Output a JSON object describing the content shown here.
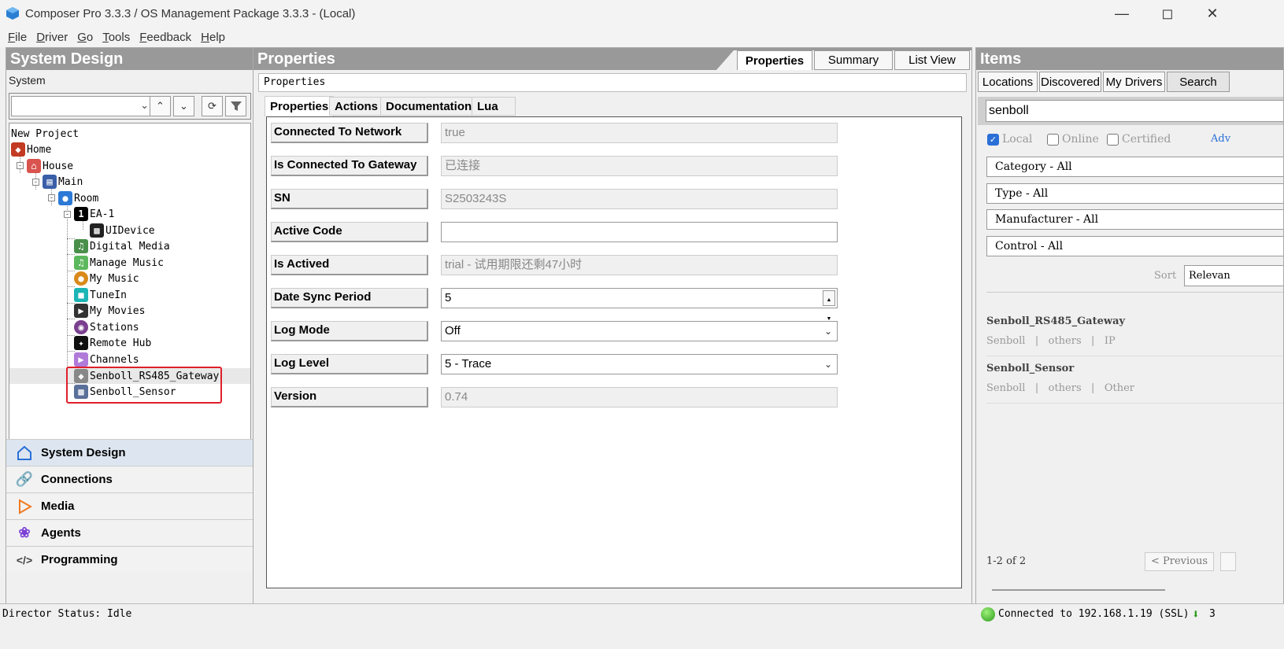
{
  "window": {
    "title": "Composer Pro 3.3.3 / OS Management Package 3.3.3 - (Local)"
  },
  "menu": [
    "File",
    "Driver",
    "Go",
    "Tools",
    "Feedback",
    "Help"
  ],
  "left": {
    "header": "System Design",
    "system_label": "System",
    "combo_value": "",
    "tree": [
      {
        "label": "New Project",
        "icon": "project-icon"
      },
      {
        "label": "Home",
        "icon": "home-icon"
      },
      {
        "label": "House",
        "icon": "house-icon"
      },
      {
        "label": "Main",
        "icon": "floor-icon"
      },
      {
        "label": "Room",
        "icon": "room-icon"
      },
      {
        "label": "EA-1",
        "icon": "controller-icon"
      },
      {
        "label": "UIDevice",
        "icon": "ui-device-icon"
      },
      {
        "label": "Digital Media",
        "icon": "digital-media-icon"
      },
      {
        "label": "Manage Music",
        "icon": "manage-music-icon"
      },
      {
        "label": "My Music",
        "icon": "my-music-icon"
      },
      {
        "label": "TuneIn",
        "icon": "tunein-icon"
      },
      {
        "label": "My Movies",
        "icon": "my-movies-icon"
      },
      {
        "label": "Stations",
        "icon": "stations-icon"
      },
      {
        "label": "Remote Hub",
        "icon": "remote-hub-icon"
      },
      {
        "label": "Channels",
        "icon": "channels-icon"
      },
      {
        "label": "Senboll_RS485_Gateway",
        "icon": "gateway-icon"
      },
      {
        "label": "Senboll_Sensor",
        "icon": "sensor-icon"
      }
    ],
    "nav": [
      "System Design",
      "Connections",
      "Media",
      "Agents",
      "Programming"
    ]
  },
  "middle": {
    "header": "Properties",
    "tabs": [
      "Properties",
      "Summary",
      "List View"
    ],
    "section_label": "Properties",
    "subtabs": [
      "Properties",
      "Actions",
      "Documentation",
      "Lua"
    ],
    "props": [
      {
        "label": "Connected To Network",
        "value": "true"
      },
      {
        "label": "Is Connected To Gateway",
        "value": "已连接"
      },
      {
        "label": "SN",
        "value": "S2503243S"
      },
      {
        "label": "Active Code",
        "value": ""
      },
      {
        "label": "Is Actived",
        "value": "trial - 试用期限还剩47小时"
      },
      {
        "label": "Date Sync Period",
        "value": "5"
      },
      {
        "label": "Log Mode",
        "value": "Off"
      },
      {
        "label": "Log Level",
        "value": "5 - Trace"
      },
      {
        "label": "Version",
        "value": "0.74"
      }
    ]
  },
  "right": {
    "header": "Items",
    "tabs": [
      "Locations",
      "Discovered",
      "My Drivers",
      "Search"
    ],
    "search_value": "senboll",
    "checks": {
      "local": "Local",
      "online": "Online",
      "certified": "Certified",
      "advanced": "Adv"
    },
    "filters": [
      "Category - All",
      "Type - All",
      "Manufacturer - All",
      "Control - All"
    ],
    "sort_label": "Sort",
    "sort_value": "Relevan",
    "results": [
      {
        "name": "Senboll_RS485_Gateway",
        "maker": "Senboll",
        "cat": "others",
        "type": "IP"
      },
      {
        "name": "Senboll_Sensor",
        "maker": "Senboll",
        "cat": "others",
        "type": "Other"
      }
    ],
    "pager_text": "1-2 of 2",
    "prev_label": "< Previous"
  },
  "status": {
    "director": "Director Status: Idle",
    "connection": "Connected to 192.168.1.19 (SSL)",
    "count": "3"
  }
}
